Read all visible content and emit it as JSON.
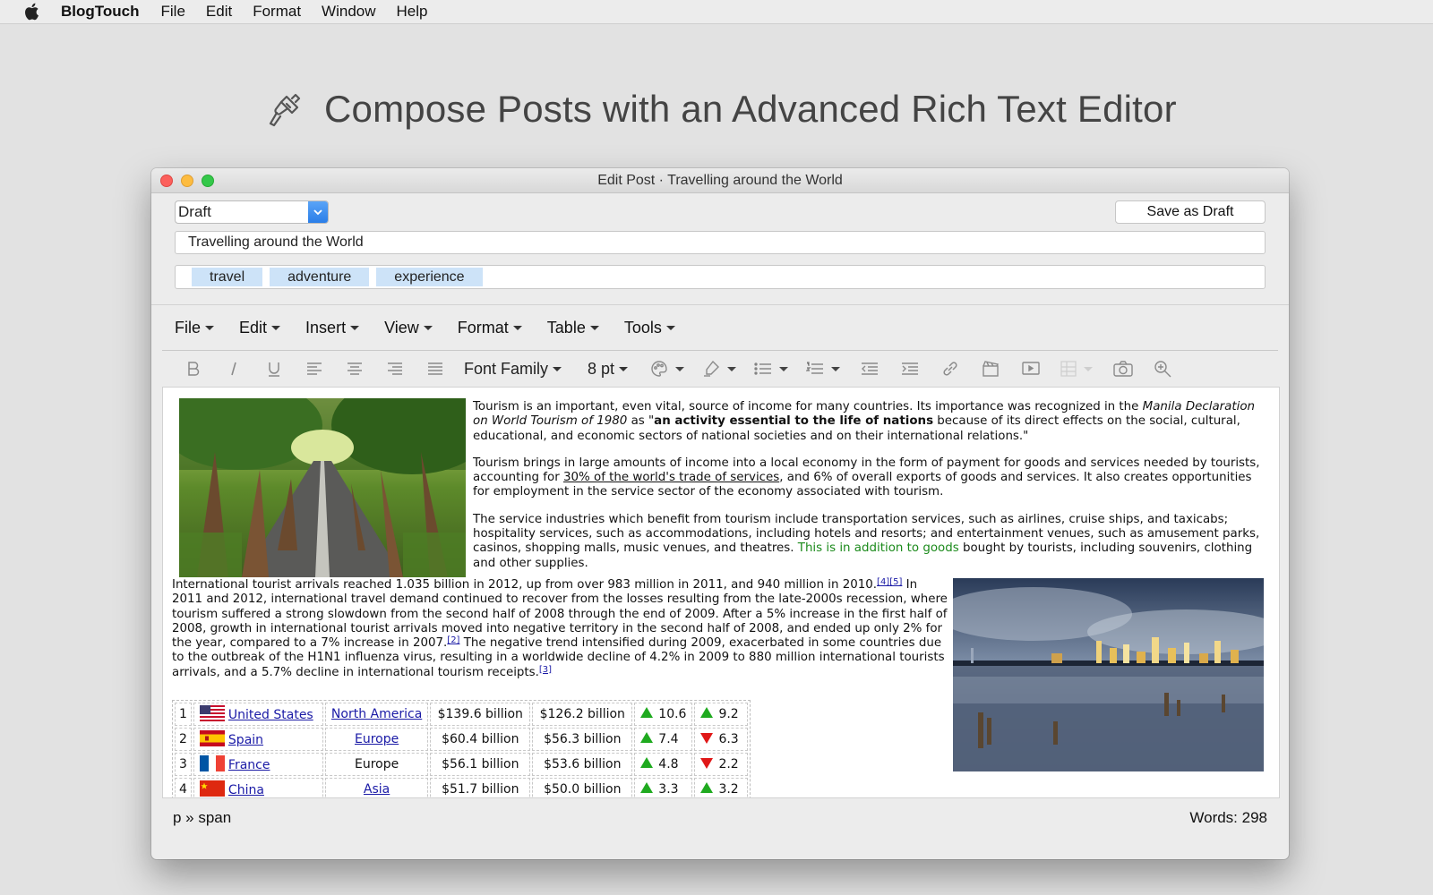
{
  "menubar": {
    "app_name": "BlogTouch",
    "items": [
      "File",
      "Edit",
      "Format",
      "Window",
      "Help"
    ]
  },
  "hero": {
    "title": "Compose Posts with an Advanced Rich Text Editor"
  },
  "window": {
    "title": "Edit Post · Travelling around the World",
    "status_value": "Draft",
    "save_label": "Save as Draft",
    "post_title": "Travelling around the World",
    "tags": [
      "travel",
      "adventure",
      "experience"
    ]
  },
  "editor_menu": [
    "File",
    "Edit",
    "Insert",
    "View",
    "Format",
    "Table",
    "Tools"
  ],
  "toolbar": {
    "font_family": "Font Family",
    "font_size": "8 pt"
  },
  "content": {
    "p1": {
      "a": "Tourism is an important, even vital, source of income for many countries. Its importance was recognized in the ",
      "a_italic": "Manila Declaration on World Tourism of 1980",
      "a2": " as \"",
      "a_bold": "an activity essential to the life of nations",
      "a3": " because of its direct effects on the social, cultural, educational, and economic sectors of national societies and on their international relations.\""
    },
    "p2": {
      "a": "Tourism brings in large amounts of income into a local economy in the form of payment for goods and services needed by tourists, accounting for ",
      "link": "30% of the world's trade of services",
      "b": ", and 6% of overall exports of goods and services. It also creates opportunities for employment in the service sector of the economy associated with tourism."
    },
    "p3": {
      "a": "The service industries which benefit from tourism include transportation services, such as airlines, cruise ships, and taxicabs; hospitality services, such as accommodations, including hotels and resorts; and entertainment venues, such as amusement parks, casinos, shopping malls, music venues, and theatres. ",
      "green": "This is in addition to goods",
      "b": " bought by tourists, including souvenirs, clothing and other supplies."
    },
    "p4": {
      "a": "International tourist arrivals reached 1.035 billion in 2012, up from over 983 million in 2011, and 940 million in 2010.",
      "sup1": "[4][5]",
      "b": " In 2011 and 2012, international travel demand continued to recover from the losses resulting from the late-2000s recession, where tourism suffered a strong slowdown from the second half of 2008 through the end of 2009. After a 5% increase in the first half of 2008, growth in international tourist arrivals moved into negative territory in the second half of 2008, and ended up only 2% for the year, compared to a 7% increase in 2007.",
      "sup2": "[2]",
      "c": " The negative trend intensified during 2009, exacerbated in some countries due to the outbreak of the H1N1 influenza virus, resulting in a worldwide decline of 4.2% in 2009 to 880 million international tourists arrivals, and a 5.7% decline in international tourism receipts.",
      "sup3": "[3]"
    },
    "table": [
      {
        "rank": "1",
        "country": "United States",
        "flag": "us-flag-icon",
        "region": "North America",
        "region_link": true,
        "v1": "$139.6 billion",
        "v2": "$126.2 billion",
        "c1_dir": "up",
        "c1": "10.6",
        "c2_dir": "up",
        "c2": "9.2"
      },
      {
        "rank": "2",
        "country": "Spain",
        "flag": "spain-flag-icon",
        "region": "Europe",
        "region_link": true,
        "v1": "$60.4 billion",
        "v2": "$56.3 billion",
        "c1_dir": "up",
        "c1": "7.4",
        "c2_dir": "down",
        "c2": "6.3"
      },
      {
        "rank": "3",
        "country": "France",
        "flag": "france-flag-icon",
        "region": "Europe",
        "region_link": false,
        "v1": "$56.1 billion",
        "v2": "$53.6 billion",
        "c1_dir": "up",
        "c1": "4.8",
        "c2_dir": "down",
        "c2": "2.2"
      },
      {
        "rank": "4",
        "country": "China",
        "flag": "china-flag-icon",
        "region": "Asia",
        "region_link": true,
        "v1": "$51.7 billion",
        "v2": "$50.0 billion",
        "c1_dir": "up",
        "c1": "3.3",
        "c2_dir": "up",
        "c2": "3.2"
      }
    ]
  },
  "statusbar": {
    "path": "p » span",
    "words": "Words: 298"
  },
  "colors": {
    "accent_blue": "#2a7ee8",
    "tag_bg": "#cde3f8",
    "link": "#1a1aa6",
    "up": "#1faa1f",
    "down": "#e01818",
    "green_text": "#1b8a1b"
  }
}
